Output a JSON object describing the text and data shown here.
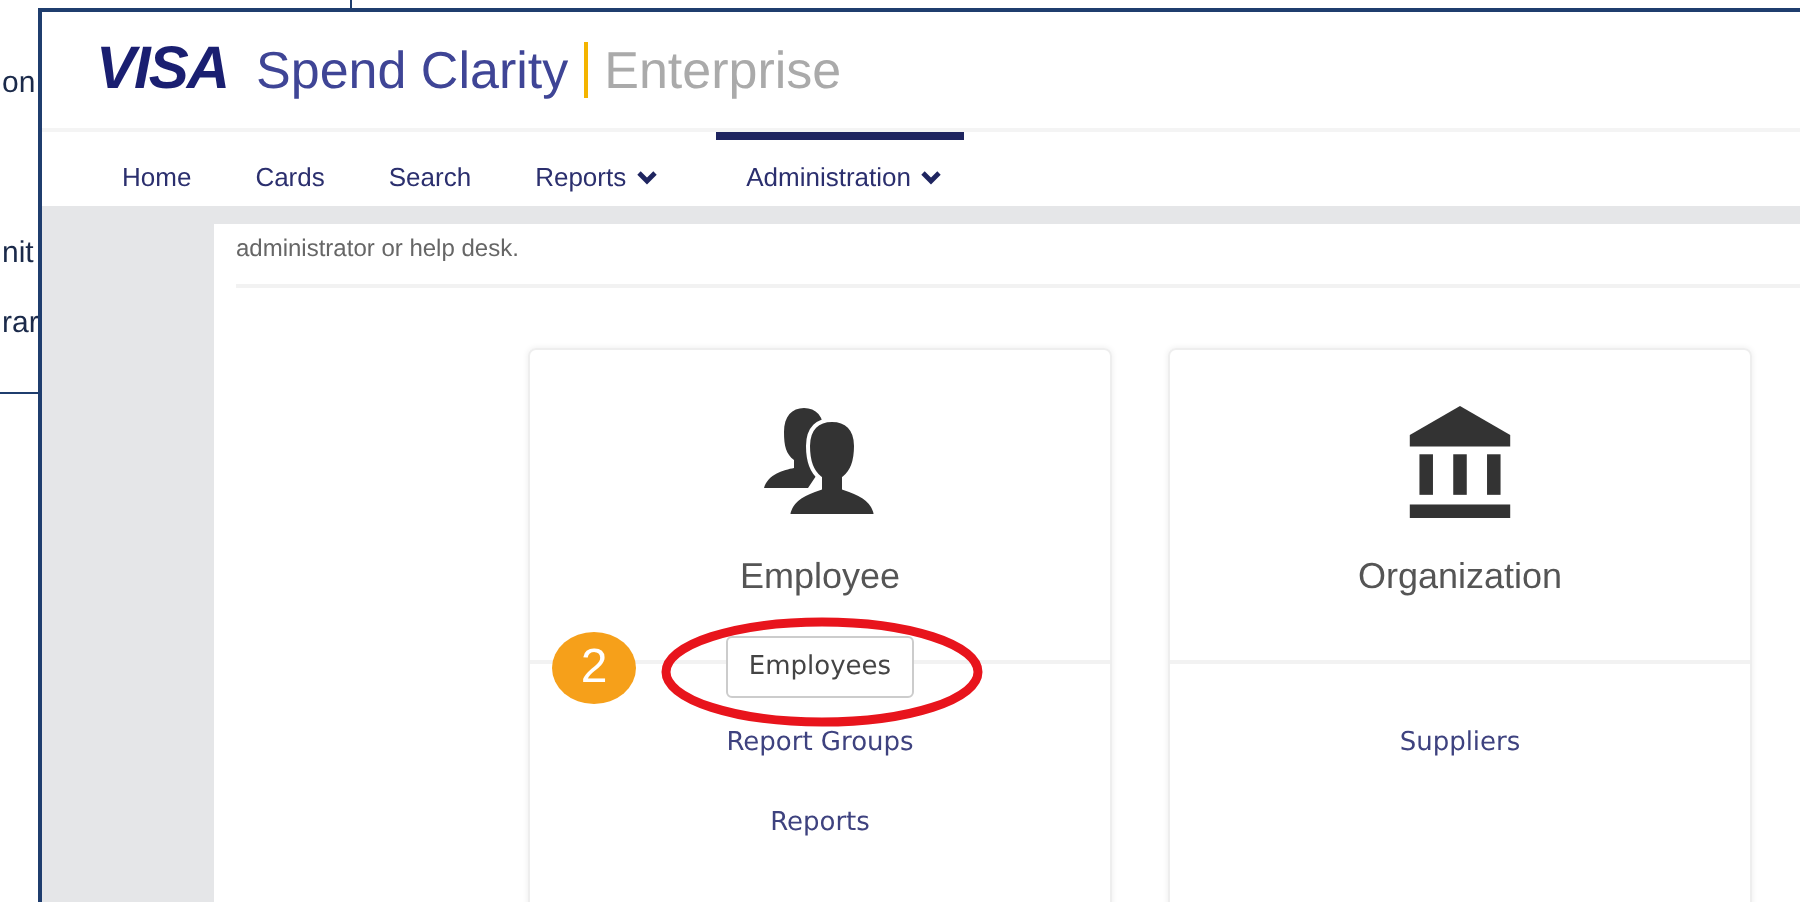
{
  "background_window": {
    "text_fragments": [
      "on",
      "nit",
      "rar"
    ]
  },
  "header": {
    "brand": "VISA",
    "product": "Spend Clarity",
    "edition": "Enterprise"
  },
  "nav": [
    {
      "label": "Home",
      "has_dropdown": false,
      "selected": false
    },
    {
      "label": "Cards",
      "has_dropdown": false,
      "selected": false
    },
    {
      "label": "Search",
      "has_dropdown": false,
      "selected": false
    },
    {
      "label": "Reports",
      "has_dropdown": true,
      "selected": false
    },
    {
      "label": "Administration",
      "has_dropdown": true,
      "selected": true
    }
  ],
  "intro_text": "administrator or help desk.",
  "cards": [
    {
      "title": "Employee",
      "kind": "people",
      "items": [
        {
          "kind": "button",
          "label": "Employees",
          "highlighted": true
        },
        {
          "kind": "link",
          "label": "Report Groups"
        },
        {
          "kind": "link",
          "label": "Reports"
        }
      ]
    },
    {
      "title": "Organization",
      "kind": "building",
      "items": [
        {
          "kind": "link",
          "label": "Suppliers"
        }
      ]
    }
  ],
  "annotation": {
    "step": "2"
  }
}
